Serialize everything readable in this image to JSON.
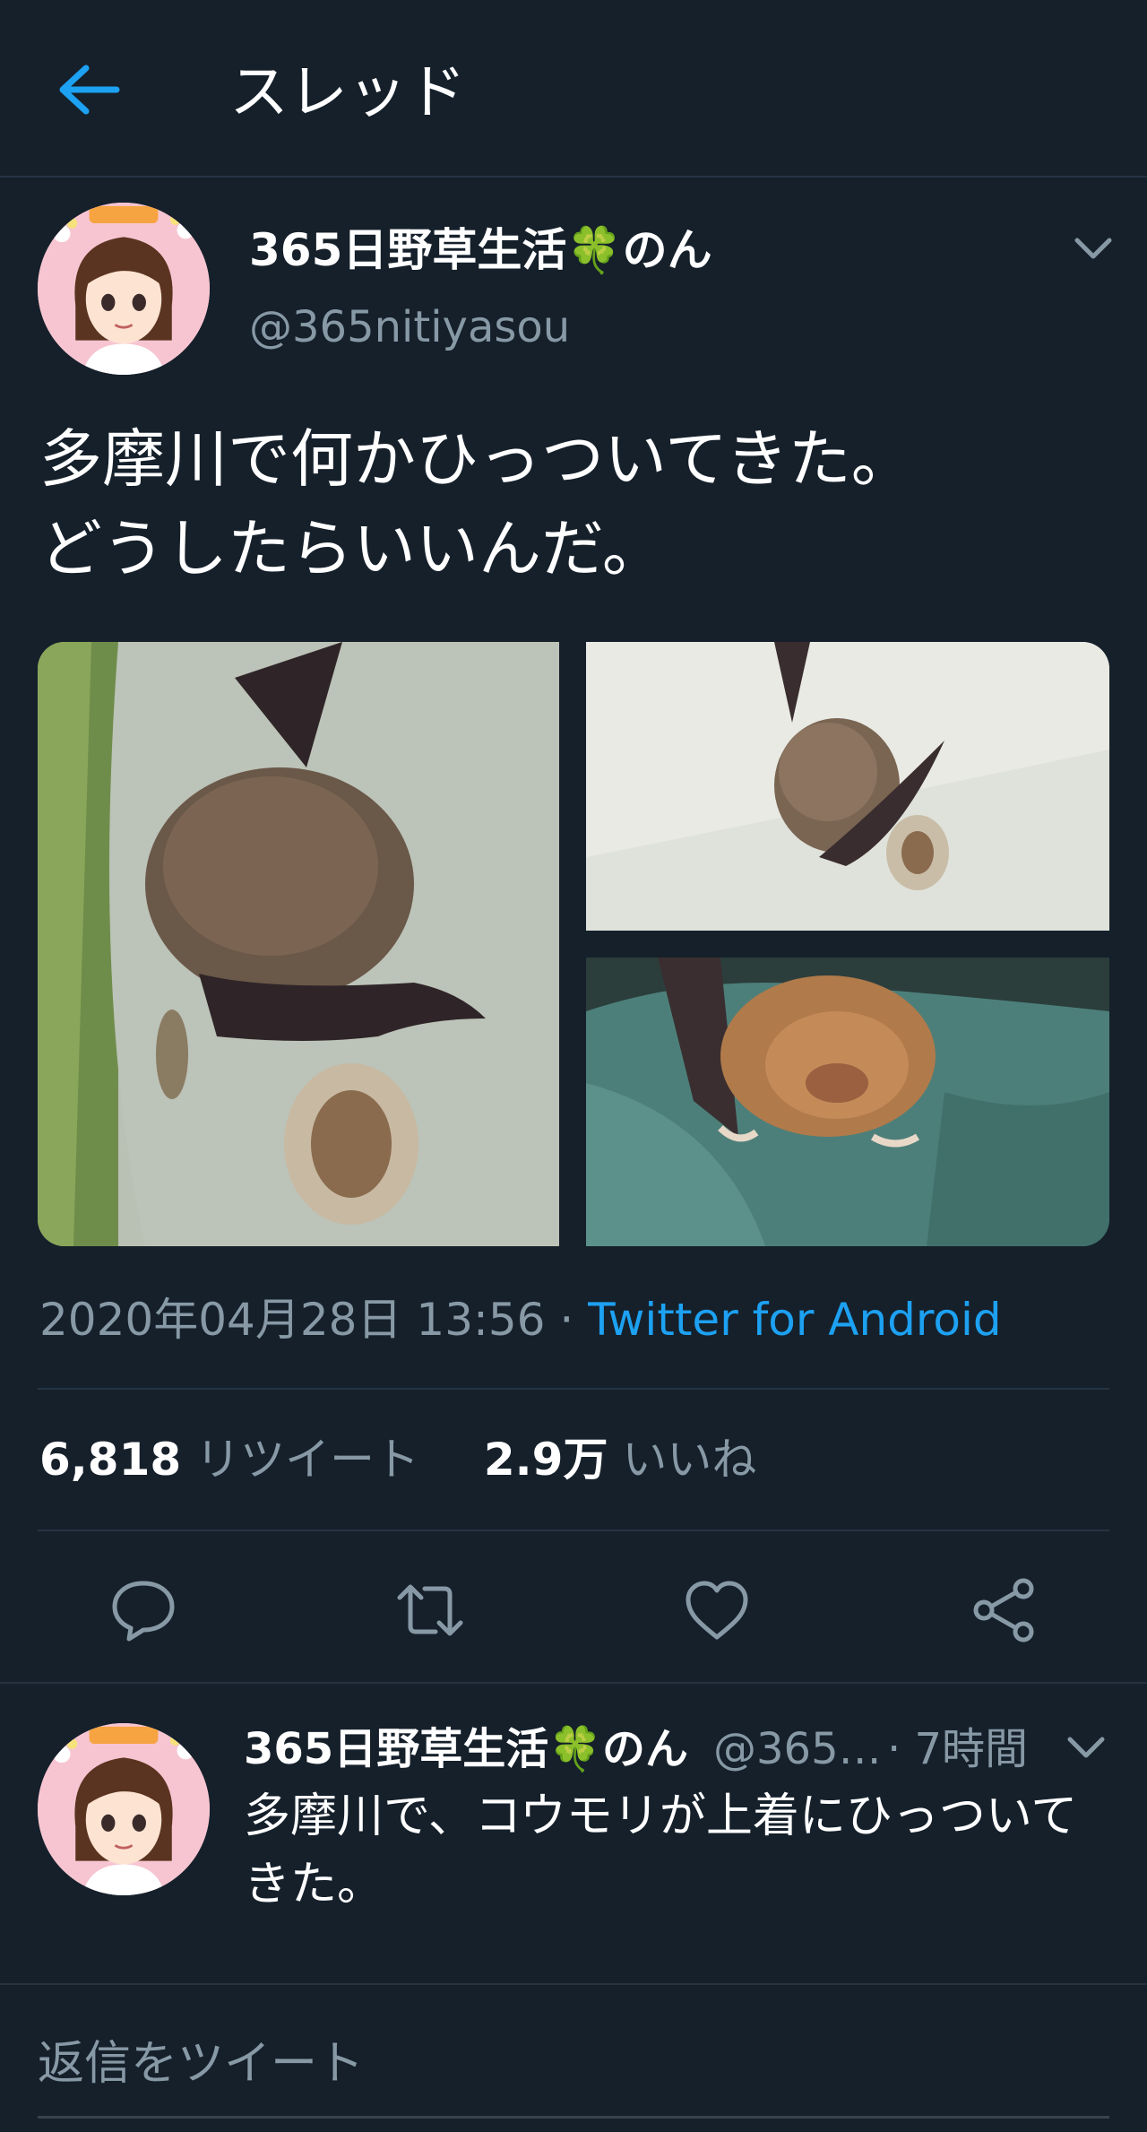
{
  "header": {
    "title": "スレッド",
    "back_icon": "arrow-left-icon"
  },
  "tweet": {
    "display_name": "365日野草生活",
    "name_suffix": "のん",
    "clover": "🍀",
    "handle": "@365nitiyasou",
    "text": "多摩川で何かひっついてきた。\nどうしたらいいんだ。",
    "timestamp": "2020年04月28日 13:56",
    "separator": " · ",
    "source": "Twitter for Android",
    "retweet_count": "6,818",
    "retweet_label": "リツイート",
    "like_count": "2.9万",
    "like_label": "いいね",
    "media_count": 3
  },
  "actions": [
    "reply-icon",
    "retweet-icon",
    "like-icon",
    "share-icon"
  ],
  "reply": {
    "display_name": "365日野草生活",
    "name_suffix": "のん",
    "clover": "🍀",
    "handle": "@365…",
    "time": "· 7時間",
    "text": "多摩川で、コウモリが上着にひっついてきた。"
  },
  "compose": {
    "placeholder": "返信をツイート"
  },
  "colors": {
    "background": "#15202b",
    "accent": "#1da1f2",
    "secondary_text": "#8899a6",
    "divider": "#253341"
  }
}
